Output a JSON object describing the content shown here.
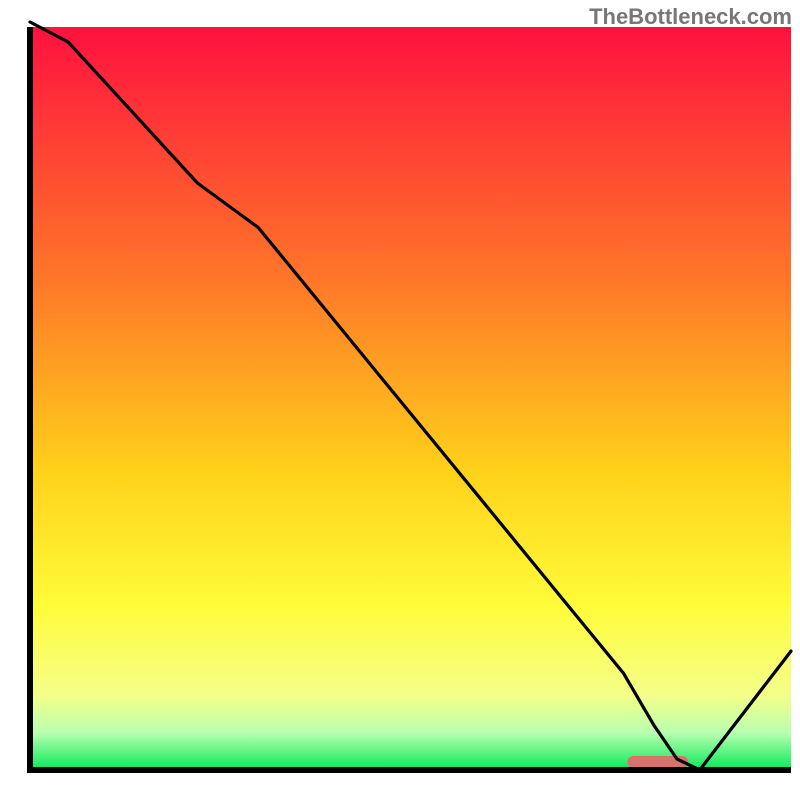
{
  "watermark": "TheBottleneck.com",
  "chart_data": {
    "type": "line",
    "title": "",
    "xlabel": "",
    "ylabel": "",
    "xlim": [
      0,
      100
    ],
    "ylim": [
      0,
      100
    ],
    "x": [
      0,
      5,
      22,
      30,
      40,
      50,
      60,
      70,
      78,
      82,
      85,
      88,
      100
    ],
    "values": [
      101,
      98,
      79,
      73,
      60.5,
      48,
      35.5,
      23,
      13,
      6,
      1.5,
      0,
      16
    ],
    "optimal_band_x": [
      78.5,
      86.5
    ],
    "gradient_stops": [
      {
        "offset": 0,
        "color": "#ff113f"
      },
      {
        "offset": 35,
        "color": "#ff7a28"
      },
      {
        "offset": 60,
        "color": "#ffd21a"
      },
      {
        "offset": 78,
        "color": "#fffc3a"
      },
      {
        "offset": 90,
        "color": "#f4ff8a"
      },
      {
        "offset": 95,
        "color": "#b8ffb0"
      },
      {
        "offset": 100,
        "color": "#08e858"
      }
    ],
    "marker_color": "#d9726b",
    "axis_color": "#000000",
    "axis_width": 6
  }
}
